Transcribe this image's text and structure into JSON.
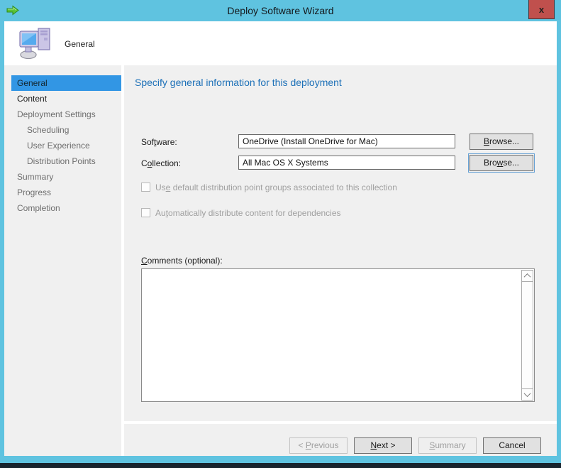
{
  "window": {
    "title": "Deploy Software Wizard",
    "close_label": "x"
  },
  "header": {
    "page_title": "General"
  },
  "sidebar": {
    "items": [
      {
        "label": "General",
        "state": "current"
      },
      {
        "label": "Content",
        "state": "available"
      },
      {
        "label": "Deployment Settings",
        "state": "pending"
      },
      {
        "label": "Scheduling",
        "state": "pending",
        "indented": true
      },
      {
        "label": "User Experience",
        "state": "pending",
        "indented": true
      },
      {
        "label": "Distribution Points",
        "state": "pending",
        "indented": true
      },
      {
        "label": "Summary",
        "state": "pending"
      },
      {
        "label": "Progress",
        "state": "pending"
      },
      {
        "label": "Completion",
        "state": "pending"
      }
    ]
  },
  "main": {
    "heading": "Specify general information for this deployment",
    "software_label": {
      "pre": "Sof",
      "key": "t",
      "post": "ware:"
    },
    "software_value": "OneDrive (Install OneDrive for Mac)",
    "software_browse": {
      "pre": "",
      "key": "B",
      "post": "rowse..."
    },
    "collection_label": {
      "pre": "C",
      "key": "o",
      "post": "llection:"
    },
    "collection_value": "All Mac OS X Systems",
    "collection_browse": {
      "pre": "Bro",
      "key": "w",
      "post": "se..."
    },
    "checkbox_dp_groups": {
      "pre": "Us",
      "key": "e",
      "post": " default distribution point groups associated to this collection",
      "checked": false,
      "enabled": false
    },
    "checkbox_auto_dist": {
      "pre": "Au",
      "key": "t",
      "post": "omatically distribute content for dependencies",
      "checked": false,
      "enabled": false
    },
    "comments_label": {
      "pre": "",
      "key": "C",
      "post": "omments (optional):"
    },
    "comments_value": ""
  },
  "footer": {
    "previous": {
      "pre": "< ",
      "key": "P",
      "post": "revious",
      "enabled": false
    },
    "next": {
      "pre": "",
      "key": "N",
      "post": "ext >",
      "enabled": true
    },
    "summary": {
      "pre": "",
      "key": "S",
      "post": "ummary",
      "enabled": false
    },
    "cancel_label": "Cancel"
  },
  "colors": {
    "titlebar": "#5fc3e0",
    "selection_blue": "#3296e4",
    "heading_blue": "#1e71b8",
    "close_button_red": "#c0504d",
    "bottom_strip": "#18242e",
    "launch_arrow_green": "#5bc236",
    "panel_gray": "#f0f0f0"
  }
}
